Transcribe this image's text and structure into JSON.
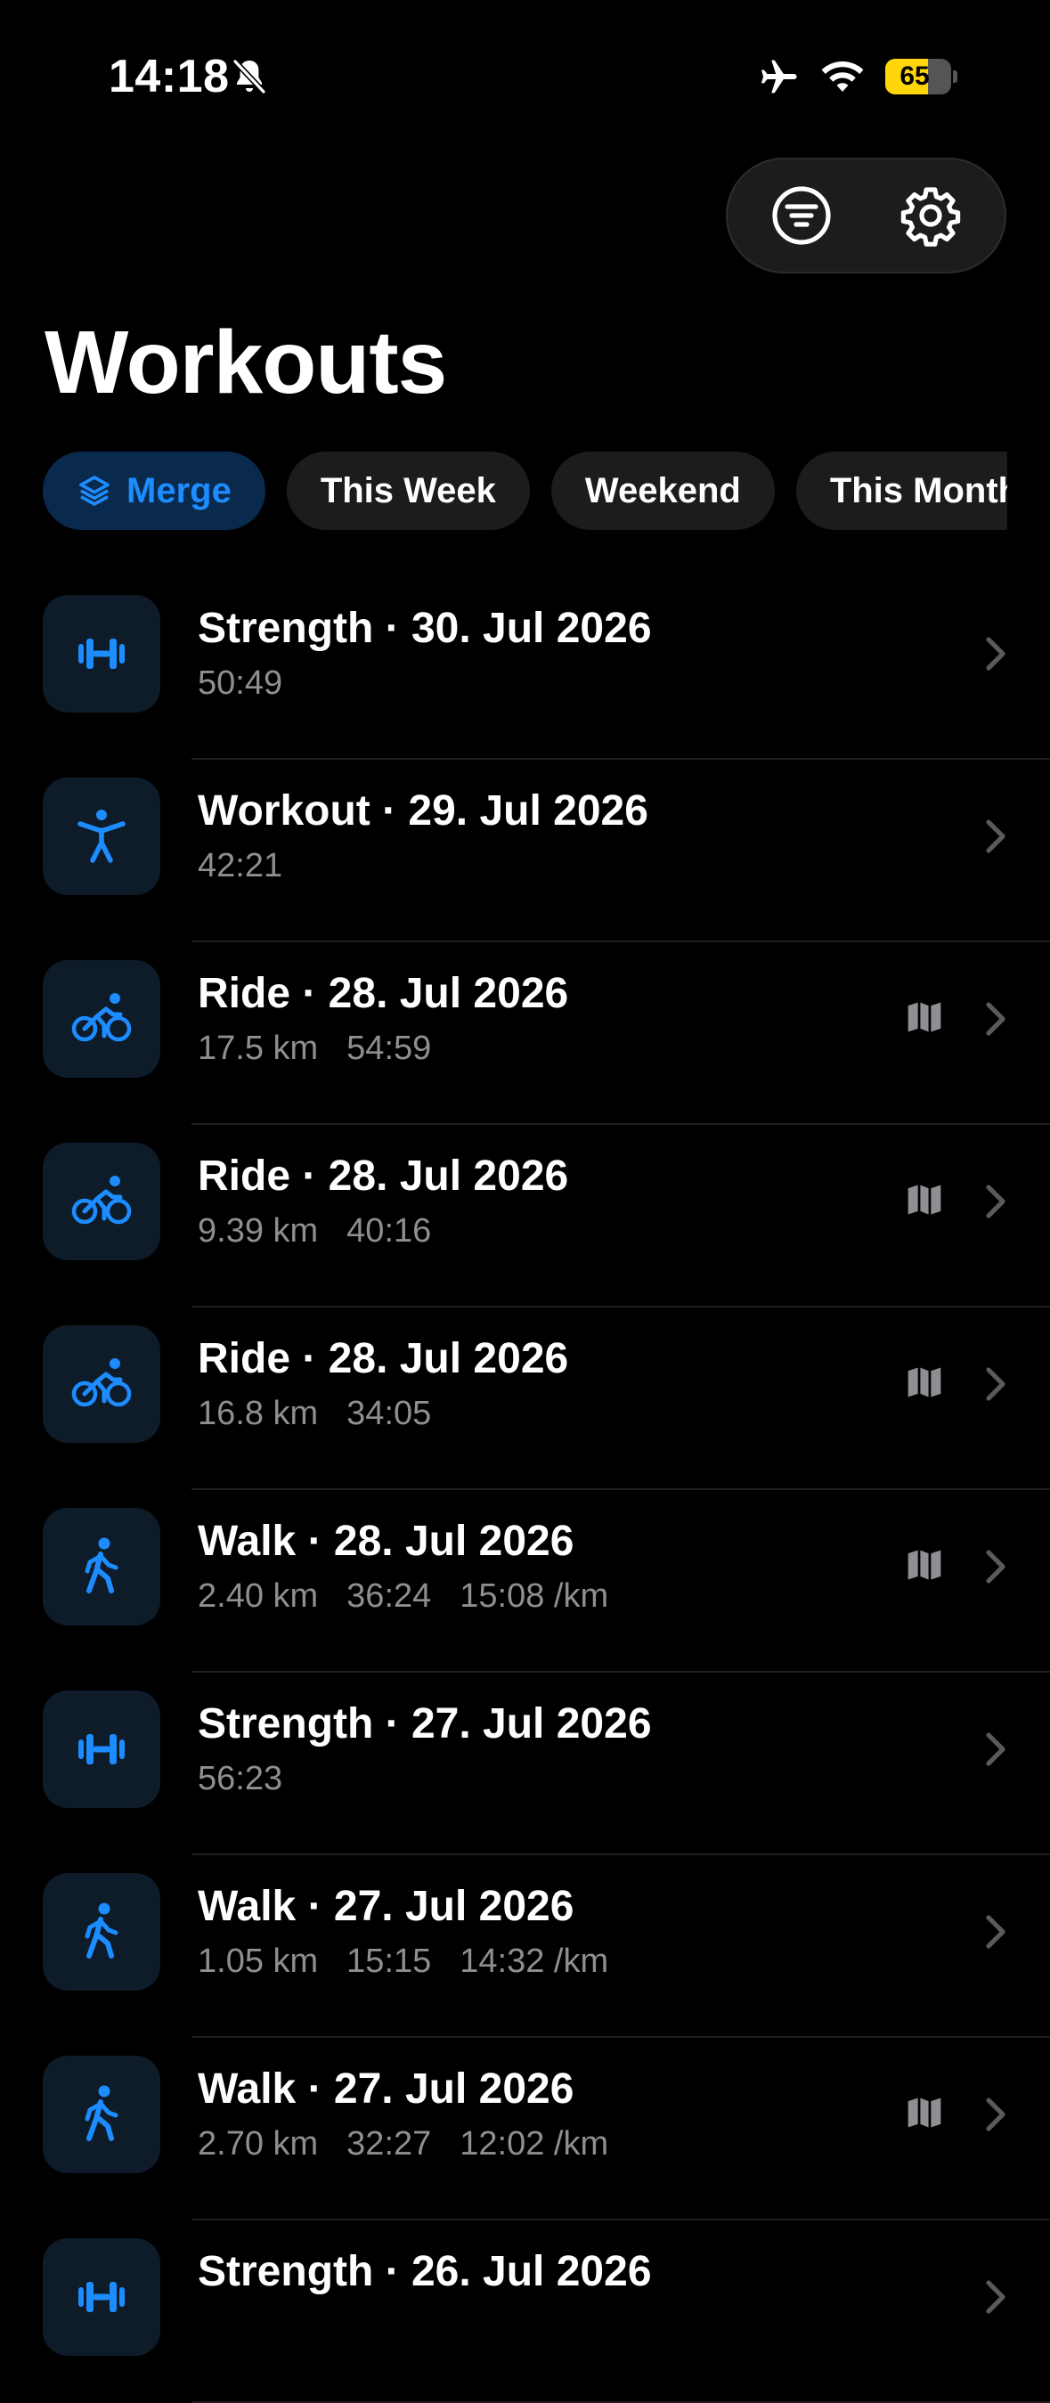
{
  "status_bar": {
    "time": "14:18",
    "battery_level": "65",
    "battery_fraction": 0.65,
    "battery_color": "#ffd60a"
  },
  "colors": {
    "accent": "#1c8cff",
    "background": "#000000",
    "secondary_text": "#8e8e93"
  },
  "header": {
    "title": "Workouts",
    "filter_icon": "filter-icon",
    "settings_icon": "gear-icon"
  },
  "chips": [
    {
      "label": "Merge",
      "icon": "stack-icon",
      "active": true
    },
    {
      "label": "This Week",
      "active": false
    },
    {
      "label": "Weekend",
      "active": false
    },
    {
      "label": "This Month",
      "active": false
    }
  ],
  "workouts": [
    {
      "type": "strength",
      "icon": "dumbbell-icon",
      "title": "Strength · 30. Jul 2026",
      "stats": [
        "50:49"
      ],
      "map": false
    },
    {
      "type": "workout",
      "icon": "figure-icon",
      "title": "Workout · 29. Jul 2026",
      "stats": [
        "42:21"
      ],
      "map": false
    },
    {
      "type": "ride",
      "icon": "bicycle-icon",
      "title": "Ride · 28. Jul 2026",
      "stats": [
        "17.5 km",
        "54:59"
      ],
      "map": true
    },
    {
      "type": "ride",
      "icon": "bicycle-icon",
      "title": "Ride · 28. Jul 2026",
      "stats": [
        "9.39 km",
        "40:16"
      ],
      "map": true
    },
    {
      "type": "ride",
      "icon": "bicycle-icon",
      "title": "Ride · 28. Jul 2026",
      "stats": [
        "16.8 km",
        "34:05"
      ],
      "map": true
    },
    {
      "type": "walk",
      "icon": "walk-icon",
      "title": "Walk · 28. Jul 2026",
      "stats": [
        "2.40 km",
        "36:24",
        "15:08 /km"
      ],
      "map": true
    },
    {
      "type": "strength",
      "icon": "dumbbell-icon",
      "title": "Strength · 27. Jul 2026",
      "stats": [
        "56:23"
      ],
      "map": false
    },
    {
      "type": "walk",
      "icon": "walk-icon",
      "title": "Walk · 27. Jul 2026",
      "stats": [
        "1.05 km",
        "15:15",
        "14:32 /km"
      ],
      "map": false
    },
    {
      "type": "walk",
      "icon": "walk-icon",
      "title": "Walk · 27. Jul 2026",
      "stats": [
        "2.70 km",
        "32:27",
        "12:02 /km"
      ],
      "map": true
    },
    {
      "type": "strength",
      "icon": "dumbbell-icon",
      "title": "Strength · 26. Jul 2026",
      "stats": [],
      "map": false
    }
  ]
}
